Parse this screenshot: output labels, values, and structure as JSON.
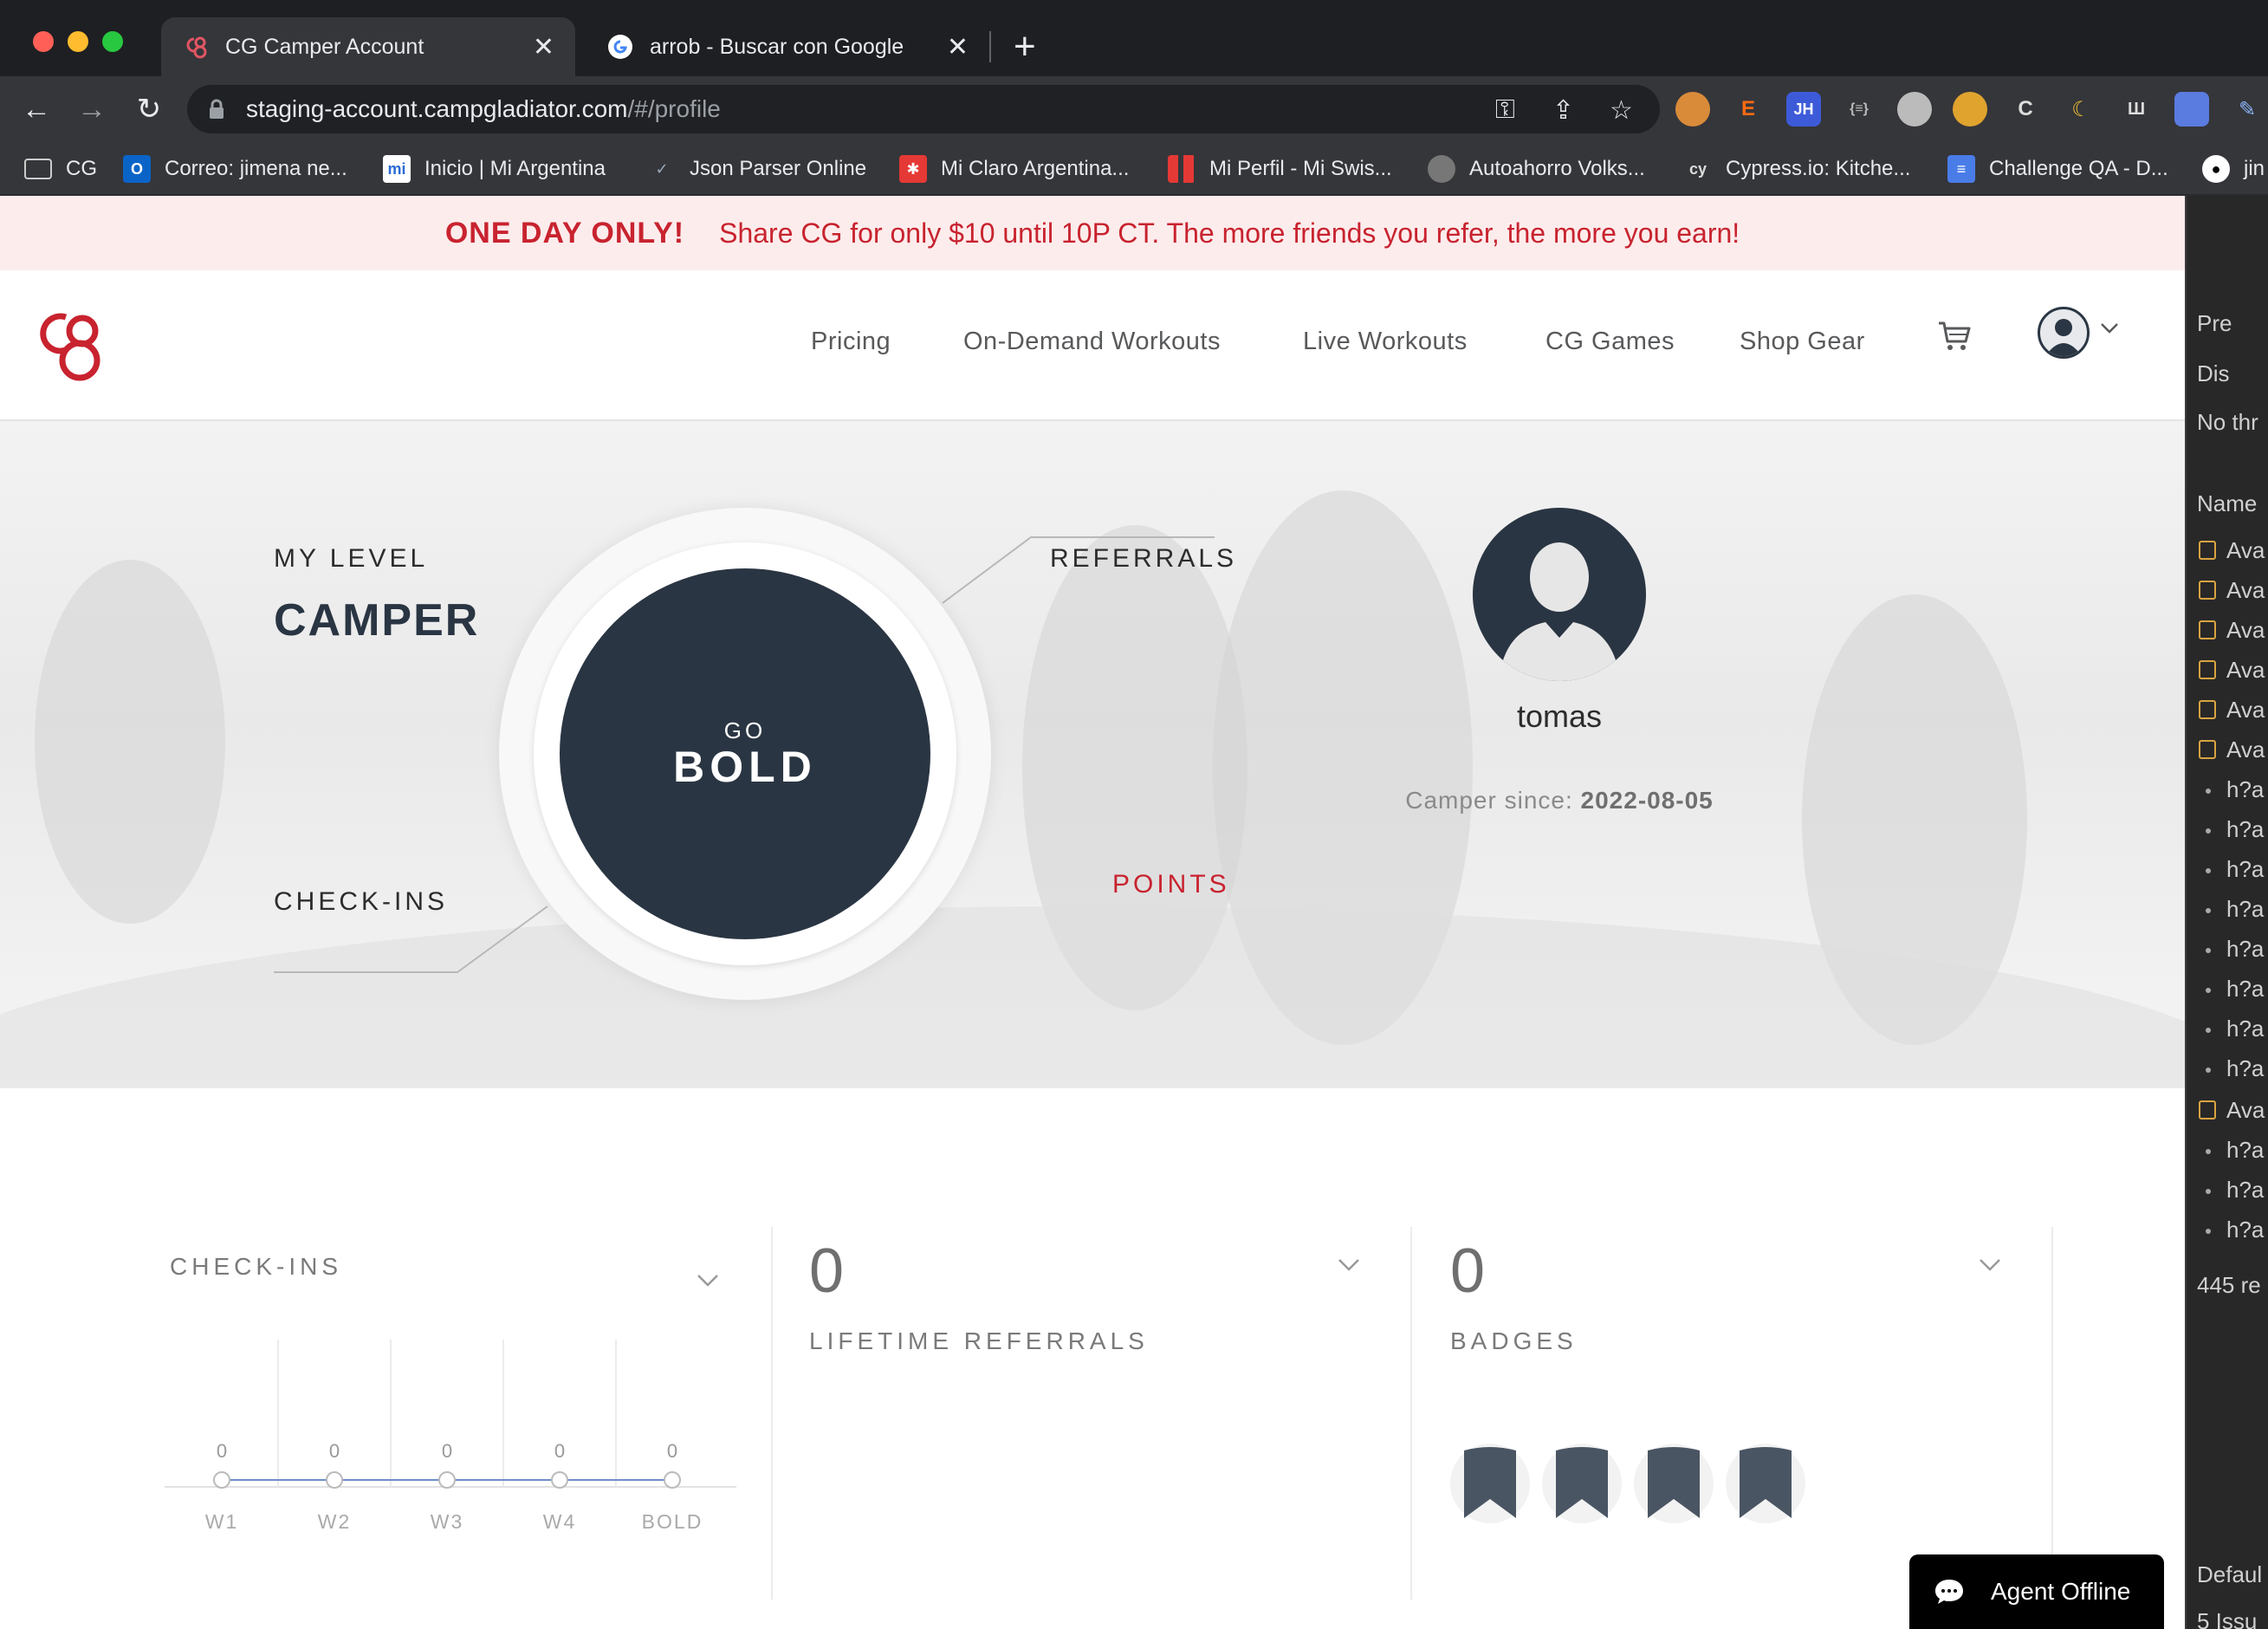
{
  "browser": {
    "tabs": [
      {
        "title": "CG Camper Account",
        "active": true,
        "close": "✕"
      },
      {
        "title": "arrob - Buscar con Google",
        "active": false,
        "close": "✕"
      }
    ],
    "new_tab": "+",
    "url_host": "staging-account.campgladiator.com",
    "url_path": "/#/profile",
    "bookmarks": [
      {
        "label": "CG",
        "icon": "folder-icon"
      },
      {
        "label": "Correo: jimena ne...",
        "icon": "outlook-icon"
      },
      {
        "label": "Inicio | Mi Argentina",
        "icon": "mi-argentina-icon"
      },
      {
        "label": "Json Parser Online",
        "icon": "check-icon"
      },
      {
        "label": "Mi Claro Argentina...",
        "icon": "claro-icon"
      },
      {
        "label": "Mi Perfil - Mi Swis...",
        "icon": "grid-icon"
      },
      {
        "label": "Autoahorro Volks...",
        "icon": "globe-icon"
      },
      {
        "label": "Cypress.io: Kitche...",
        "icon": "cypress-icon"
      },
      {
        "label": "Challenge QA - D...",
        "icon": "doc-icon"
      },
      {
        "label": "jin",
        "icon": "github-icon"
      }
    ],
    "extensions": [
      "cookie-icon",
      "E",
      "JH",
      "{≡}",
      "gear",
      "eye",
      "C",
      "moon",
      "type",
      "screen",
      "pen"
    ]
  },
  "promo": {
    "headline": "ONE DAY ONLY!",
    "message": "Share CG for only $10 until 10P CT. The more friends you refer, the more you earn!"
  },
  "header": {
    "nav": [
      "Pricing",
      "On-Demand Workouts",
      "Live Workouts",
      "CG Games",
      "Shop Gear"
    ]
  },
  "hero": {
    "my_level_label": "MY LEVEL",
    "my_level_value": "CAMPER",
    "referrals_label": "REFERRALS",
    "checkins_label": "CHECK-INS",
    "points_label": "POINTS",
    "core_top": "GO",
    "core_main": "BOLD",
    "username": "tomas",
    "camper_since_label": "Camper since: ",
    "camper_since_value": "2022-08-05"
  },
  "stats": {
    "checkins": {
      "title": "CHECK-INS",
      "points": [
        {
          "label": "W1",
          "value": "0"
        },
        {
          "label": "W2",
          "value": "0"
        },
        {
          "label": "W3",
          "value": "0"
        },
        {
          "label": "W4",
          "value": "0"
        },
        {
          "label": "BOLD",
          "value": "0"
        }
      ]
    },
    "referrals": {
      "value": "0",
      "title": "LIFETIME REFERRALS"
    },
    "badges": {
      "value": "0",
      "title": "BADGES",
      "count": 4
    }
  },
  "chat": {
    "label": "Agent Offline"
  },
  "devtools": {
    "rows": [
      "Pre",
      "Dis",
      "No thr",
      "Name",
      "Ava",
      "Ava",
      "Ava",
      "Ava",
      "Ava",
      "Ava",
      "h?a",
      "h?a",
      "h?a",
      "h?a",
      "h?a",
      "h?a",
      "h?a",
      "h?a",
      "Ava",
      "h?a",
      "h?a",
      "h?a",
      "445 re",
      "Defaul",
      "5 Issu"
    ]
  },
  "colors": {
    "brand_red": "#c8232f",
    "navy": "#2a3543",
    "promo_bg": "#fdecec"
  }
}
